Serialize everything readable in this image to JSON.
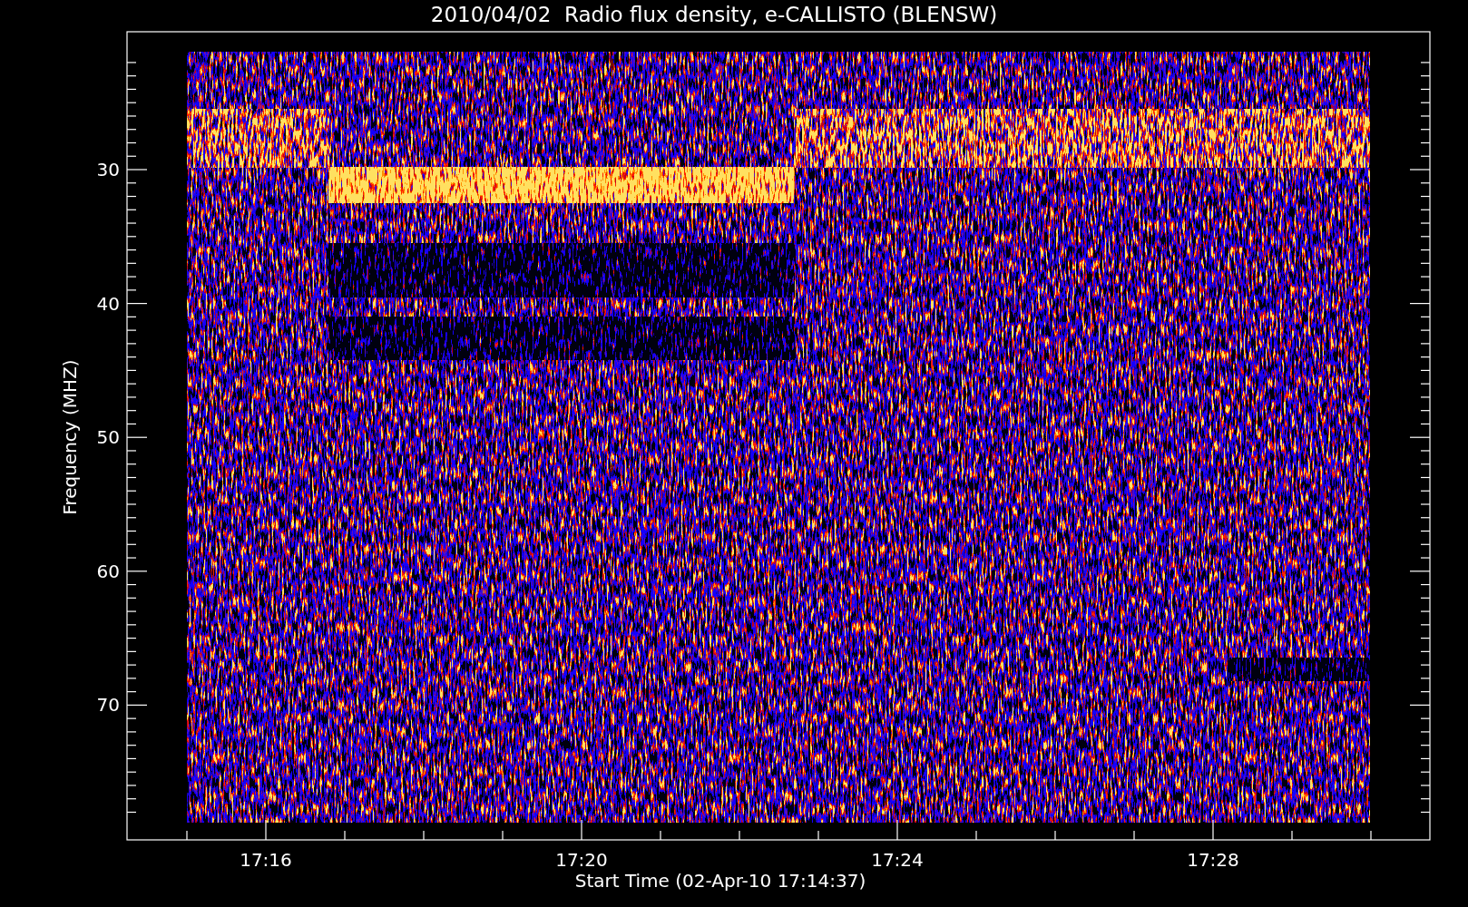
{
  "plot": {
    "title": "2010/04/02  Radio flux density, e-CALLISTO (BLENSW)",
    "ylabel": "Frequency (MHZ)",
    "xlabel": "Start Time (02-Apr-10 17:14:37)",
    "yticks": [
      "30",
      "40",
      "50",
      "60",
      "70"
    ],
    "xticks": [
      "17:16",
      "17:20",
      "17:24",
      "17:28"
    ]
  }
}
